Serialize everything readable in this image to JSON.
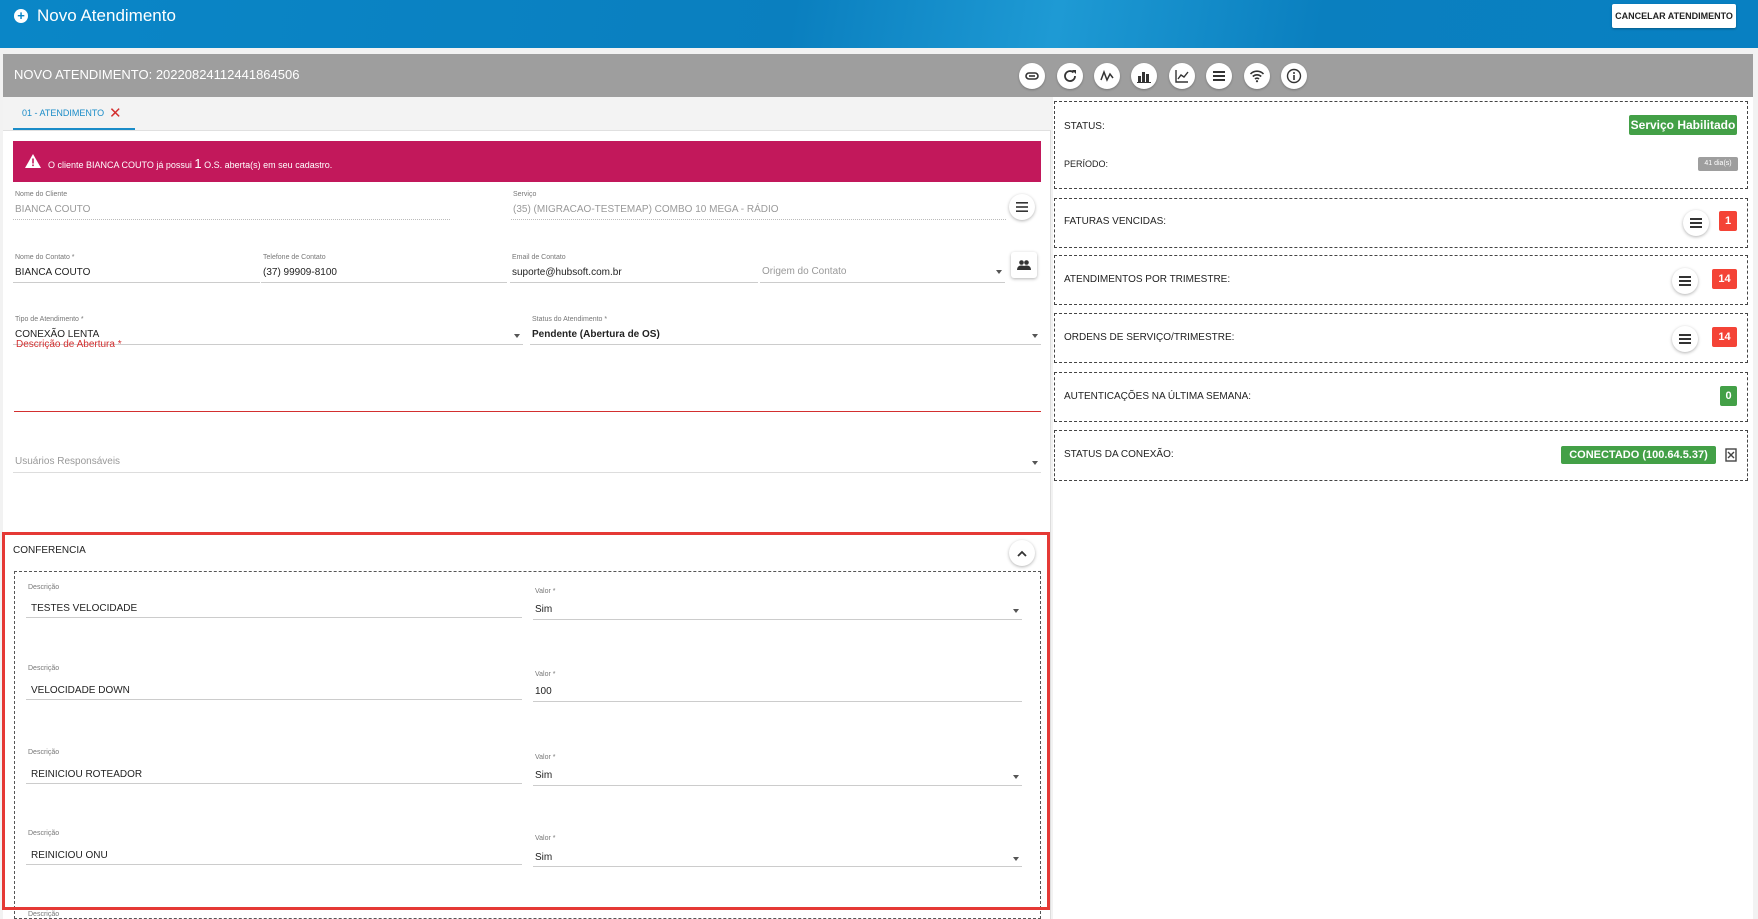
{
  "topbar": {
    "title": "Novo Atendimento",
    "cancel_label": "CANCELAR ATENDIMENTO"
  },
  "header": {
    "title": "NOVO ATENDIMENTO: 20220824112441864506",
    "icons": [
      "link-icon",
      "refresh-icon",
      "signal-icon",
      "bar-chart-icon",
      "line-chart-icon",
      "list-icon",
      "wifi-icon",
      "info-icon"
    ]
  },
  "tab": {
    "label": "01 - ATENDIMENTO",
    "close": "✕"
  },
  "alert": {
    "prefix": "O cliente BIANCA COUTO já possui",
    "count": "1",
    "suffix": "O.S. aberta(s) em seu cadastro."
  },
  "form": {
    "cliente": {
      "label": "Nome do Cliente",
      "value": "BIANCA COUTO"
    },
    "servico": {
      "label": "Serviço",
      "value": "(35) (MIGRACAO-TESTEMAP) COMBO 10 MEGA - RÁDIO"
    },
    "contato": {
      "label": "Nome do Contato *",
      "value": "BIANCA COUTO"
    },
    "telefone": {
      "label": "Telefone de Contato",
      "value": "(37) 99909-8100"
    },
    "email": {
      "label": "Email de Contato",
      "value": "suporte@hubsoft.com.br"
    },
    "origem": {
      "placeholder": "Origem do Contato"
    },
    "tipo": {
      "label": "Tipo de Atendimento *",
      "value": "CONEXÃO LENTA"
    },
    "status": {
      "label": "Status do Atendimento *",
      "value": "Pendente (Abertura de OS)"
    },
    "descricao": {
      "label": "Descrição de Abertura *"
    },
    "usuarios": {
      "placeholder": "Usuários Responsáveis"
    }
  },
  "conferencia": {
    "title": "CONFERENCIA",
    "desc_label": "Descrição",
    "valor_label": "Valor *",
    "items": [
      {
        "descricao": "TESTES VELOCIDADE",
        "valor": "Sim"
      },
      {
        "descricao": "VELOCIDADE DOWN",
        "valor": "100"
      },
      {
        "descricao": "REINICIOU ROTEADOR",
        "valor": "Sim"
      },
      {
        "descricao": "REINICIOU ONU",
        "valor": "Sim"
      }
    ],
    "next_desc_label": "Descrição"
  },
  "right": {
    "status_label": "STATUS:",
    "status_value": "Serviço Habilitado",
    "periodo_label": "PERÍODO:",
    "periodo_value": "41 dia(s)",
    "faturas_label": "FATURAS VENCIDAS:",
    "faturas_value": "1",
    "atend_label": "ATENDIMENTOS POR TRIMESTRE:",
    "atend_value": "14",
    "ordens_label": "ORDENS DE SERVIÇO/TRIMESTRE:",
    "ordens_value": "14",
    "auth_label": "AUTENTICAÇÕES NA ÚLTIMA SEMANA:",
    "auth_value": "0",
    "conexao_label": "STATUS DA CONEXÃO:",
    "conexao_value": "CONECTADO (100.64.5.37)"
  },
  "colors": {
    "primary": "#0a86c7",
    "alert": "#c2185b",
    "success": "#43a047",
    "danger": "#f44336",
    "highlight": "#e53935"
  }
}
